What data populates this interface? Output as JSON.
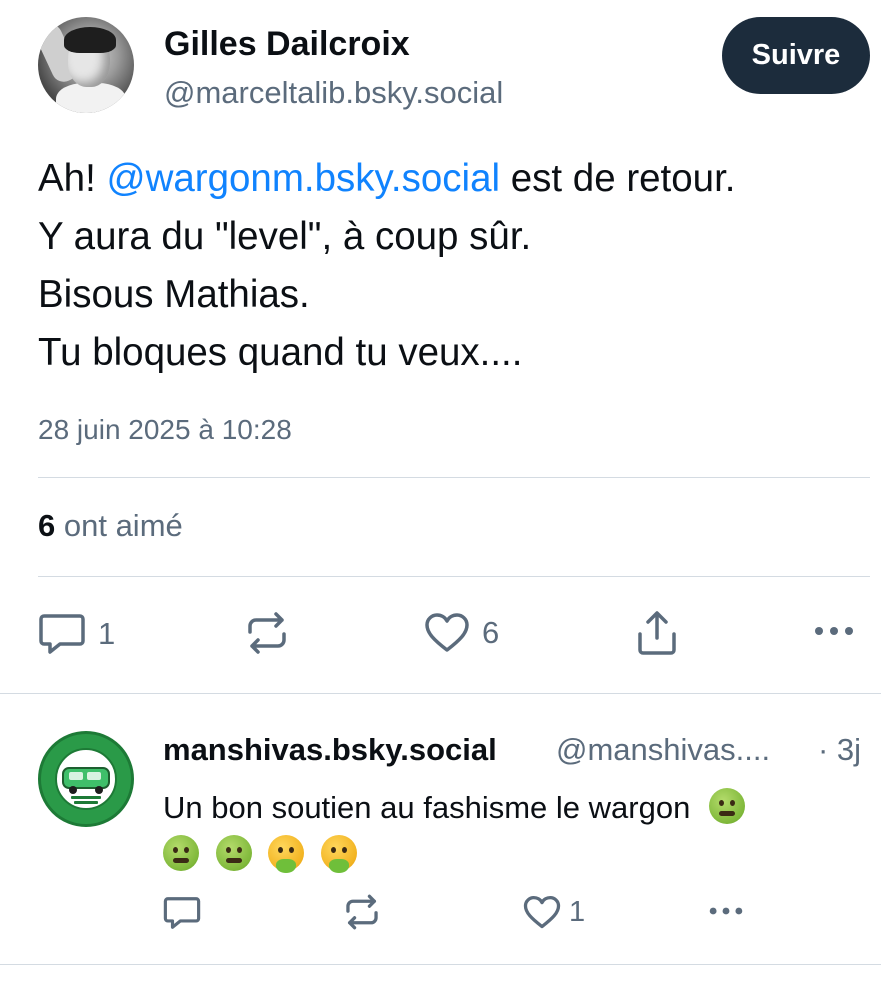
{
  "post": {
    "author": {
      "display_name": "Gilles Dailcroix",
      "handle": "@marceltalib.bsky.social"
    },
    "follow_label": "Suivre",
    "text": {
      "line1_prefix": "Ah! ",
      "line1_mention": "@wargonm.bsky.social",
      "line1_suffix": " est de retour.",
      "line2": "Y aura du \"level\", à coup sûr.",
      "line3": "Bisous Mathias.",
      "line4": "Tu bloques quand tu veux...."
    },
    "timestamp": "28 juin 2025 à 10:28",
    "likes": {
      "count": "6",
      "label": " ont aimé"
    },
    "actions": {
      "reply_count": "1",
      "like_count": "6"
    }
  },
  "reply": {
    "display_name": "manshivas.bsky.social",
    "handle": "@manshivas....",
    "time": "· 3j",
    "text": "Un bon soutien au fashisme le wargon",
    "emojis": [
      "nauseated-face",
      "nauseated-face",
      "nauseated-face",
      "face-vomiting",
      "face-vomiting"
    ],
    "actions": {
      "reply_count": "",
      "like_count": "1"
    }
  },
  "colors": {
    "accent": "#1083fe",
    "button_bg": "#1c2c3c",
    "muted_text": "#5b6b7c",
    "divider": "#d4dbe2"
  }
}
